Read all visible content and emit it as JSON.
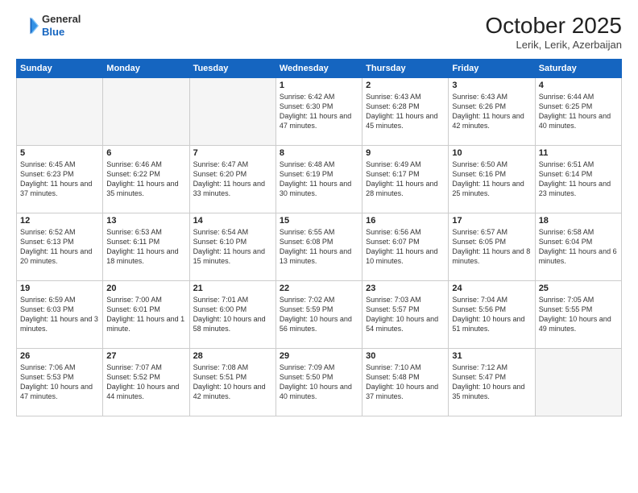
{
  "header": {
    "logo": {
      "general": "General",
      "blue": "Blue"
    },
    "title": "October 2025",
    "location": "Lerik, Lerik, Azerbaijan"
  },
  "weekdays": [
    "Sunday",
    "Monday",
    "Tuesday",
    "Wednesday",
    "Thursday",
    "Friday",
    "Saturday"
  ],
  "weeks": [
    [
      {
        "day": "",
        "empty": true
      },
      {
        "day": "",
        "empty": true
      },
      {
        "day": "",
        "empty": true
      },
      {
        "day": "1",
        "sunrise": "Sunrise: 6:42 AM",
        "sunset": "Sunset: 6:30 PM",
        "daylight": "Daylight: 11 hours and 47 minutes."
      },
      {
        "day": "2",
        "sunrise": "Sunrise: 6:43 AM",
        "sunset": "Sunset: 6:28 PM",
        "daylight": "Daylight: 11 hours and 45 minutes."
      },
      {
        "day": "3",
        "sunrise": "Sunrise: 6:43 AM",
        "sunset": "Sunset: 6:26 PM",
        "daylight": "Daylight: 11 hours and 42 minutes."
      },
      {
        "day": "4",
        "sunrise": "Sunrise: 6:44 AM",
        "sunset": "Sunset: 6:25 PM",
        "daylight": "Daylight: 11 hours and 40 minutes."
      }
    ],
    [
      {
        "day": "5",
        "sunrise": "Sunrise: 6:45 AM",
        "sunset": "Sunset: 6:23 PM",
        "daylight": "Daylight: 11 hours and 37 minutes."
      },
      {
        "day": "6",
        "sunrise": "Sunrise: 6:46 AM",
        "sunset": "Sunset: 6:22 PM",
        "daylight": "Daylight: 11 hours and 35 minutes."
      },
      {
        "day": "7",
        "sunrise": "Sunrise: 6:47 AM",
        "sunset": "Sunset: 6:20 PM",
        "daylight": "Daylight: 11 hours and 33 minutes."
      },
      {
        "day": "8",
        "sunrise": "Sunrise: 6:48 AM",
        "sunset": "Sunset: 6:19 PM",
        "daylight": "Daylight: 11 hours and 30 minutes."
      },
      {
        "day": "9",
        "sunrise": "Sunrise: 6:49 AM",
        "sunset": "Sunset: 6:17 PM",
        "daylight": "Daylight: 11 hours and 28 minutes."
      },
      {
        "day": "10",
        "sunrise": "Sunrise: 6:50 AM",
        "sunset": "Sunset: 6:16 PM",
        "daylight": "Daylight: 11 hours and 25 minutes."
      },
      {
        "day": "11",
        "sunrise": "Sunrise: 6:51 AM",
        "sunset": "Sunset: 6:14 PM",
        "daylight": "Daylight: 11 hours and 23 minutes."
      }
    ],
    [
      {
        "day": "12",
        "sunrise": "Sunrise: 6:52 AM",
        "sunset": "Sunset: 6:13 PM",
        "daylight": "Daylight: 11 hours and 20 minutes."
      },
      {
        "day": "13",
        "sunrise": "Sunrise: 6:53 AM",
        "sunset": "Sunset: 6:11 PM",
        "daylight": "Daylight: 11 hours and 18 minutes."
      },
      {
        "day": "14",
        "sunrise": "Sunrise: 6:54 AM",
        "sunset": "Sunset: 6:10 PM",
        "daylight": "Daylight: 11 hours and 15 minutes."
      },
      {
        "day": "15",
        "sunrise": "Sunrise: 6:55 AM",
        "sunset": "Sunset: 6:08 PM",
        "daylight": "Daylight: 11 hours and 13 minutes."
      },
      {
        "day": "16",
        "sunrise": "Sunrise: 6:56 AM",
        "sunset": "Sunset: 6:07 PM",
        "daylight": "Daylight: 11 hours and 10 minutes."
      },
      {
        "day": "17",
        "sunrise": "Sunrise: 6:57 AM",
        "sunset": "Sunset: 6:05 PM",
        "daylight": "Daylight: 11 hours and 8 minutes."
      },
      {
        "day": "18",
        "sunrise": "Sunrise: 6:58 AM",
        "sunset": "Sunset: 6:04 PM",
        "daylight": "Daylight: 11 hours and 6 minutes."
      }
    ],
    [
      {
        "day": "19",
        "sunrise": "Sunrise: 6:59 AM",
        "sunset": "Sunset: 6:03 PM",
        "daylight": "Daylight: 11 hours and 3 minutes."
      },
      {
        "day": "20",
        "sunrise": "Sunrise: 7:00 AM",
        "sunset": "Sunset: 6:01 PM",
        "daylight": "Daylight: 11 hours and 1 minute."
      },
      {
        "day": "21",
        "sunrise": "Sunrise: 7:01 AM",
        "sunset": "Sunset: 6:00 PM",
        "daylight": "Daylight: 10 hours and 58 minutes."
      },
      {
        "day": "22",
        "sunrise": "Sunrise: 7:02 AM",
        "sunset": "Sunset: 5:59 PM",
        "daylight": "Daylight: 10 hours and 56 minutes."
      },
      {
        "day": "23",
        "sunrise": "Sunrise: 7:03 AM",
        "sunset": "Sunset: 5:57 PM",
        "daylight": "Daylight: 10 hours and 54 minutes."
      },
      {
        "day": "24",
        "sunrise": "Sunrise: 7:04 AM",
        "sunset": "Sunset: 5:56 PM",
        "daylight": "Daylight: 10 hours and 51 minutes."
      },
      {
        "day": "25",
        "sunrise": "Sunrise: 7:05 AM",
        "sunset": "Sunset: 5:55 PM",
        "daylight": "Daylight: 10 hours and 49 minutes."
      }
    ],
    [
      {
        "day": "26",
        "sunrise": "Sunrise: 7:06 AM",
        "sunset": "Sunset: 5:53 PM",
        "daylight": "Daylight: 10 hours and 47 minutes."
      },
      {
        "day": "27",
        "sunrise": "Sunrise: 7:07 AM",
        "sunset": "Sunset: 5:52 PM",
        "daylight": "Daylight: 10 hours and 44 minutes."
      },
      {
        "day": "28",
        "sunrise": "Sunrise: 7:08 AM",
        "sunset": "Sunset: 5:51 PM",
        "daylight": "Daylight: 10 hours and 42 minutes."
      },
      {
        "day": "29",
        "sunrise": "Sunrise: 7:09 AM",
        "sunset": "Sunset: 5:50 PM",
        "daylight": "Daylight: 10 hours and 40 minutes."
      },
      {
        "day": "30",
        "sunrise": "Sunrise: 7:10 AM",
        "sunset": "Sunset: 5:48 PM",
        "daylight": "Daylight: 10 hours and 37 minutes."
      },
      {
        "day": "31",
        "sunrise": "Sunrise: 7:12 AM",
        "sunset": "Sunset: 5:47 PM",
        "daylight": "Daylight: 10 hours and 35 minutes."
      },
      {
        "day": "",
        "empty": true
      }
    ]
  ]
}
